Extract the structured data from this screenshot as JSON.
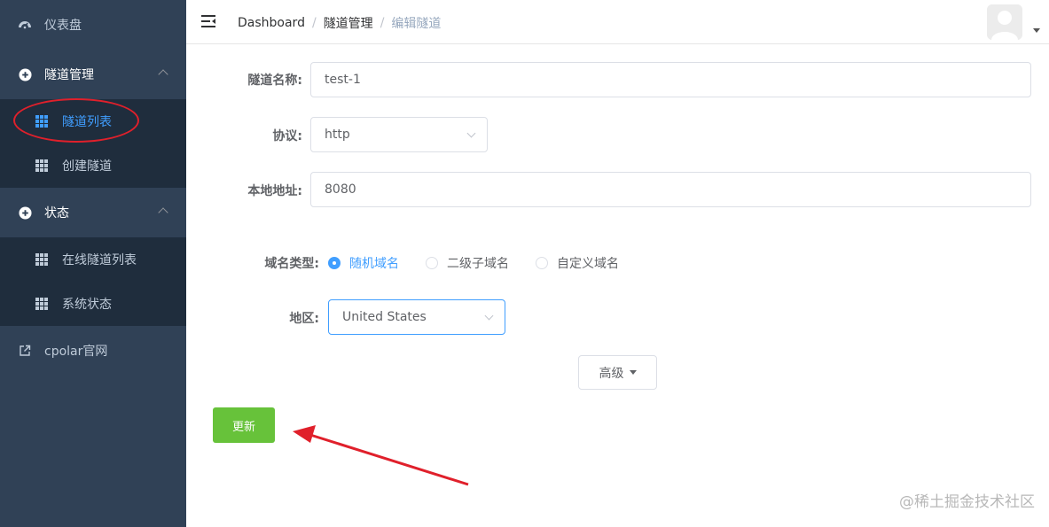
{
  "sidebar": {
    "dashboard": {
      "label": "仪表盘",
      "icon": "speedometer-icon"
    },
    "tunnel_mgmt": {
      "label": "隧道管理",
      "icon": "plus-circle-icon",
      "items": [
        {
          "label": "隧道列表",
          "icon": "table-icon",
          "active": true
        },
        {
          "label": "创建隧道",
          "icon": "table-icon"
        }
      ]
    },
    "status": {
      "label": "状态",
      "icon": "plus-circle-icon",
      "items": [
        {
          "label": "在线隧道列表",
          "icon": "table-icon"
        },
        {
          "label": "系统状态",
          "icon": "table-icon"
        }
      ]
    },
    "website": {
      "label": "cpolar官网",
      "icon": "external-link-icon"
    }
  },
  "header": {
    "breadcrumb": [
      "Dashboard",
      "隧道管理",
      "编辑隧道"
    ]
  },
  "form": {
    "name": {
      "label": "隧道名称:",
      "value": "test-1"
    },
    "protocol": {
      "label": "协议:",
      "value": "http"
    },
    "local_addr": {
      "label": "本地地址:",
      "value": "8080"
    },
    "domain_type": {
      "label": "域名类型:",
      "options": [
        "随机域名",
        "二级子域名",
        "自定义域名"
      ],
      "selected": "随机域名"
    },
    "region": {
      "label": "地区:",
      "value": "United States"
    },
    "advanced_label": "高级",
    "update_label": "更新"
  },
  "watermark": "@稀土掘金技术社区",
  "colors": {
    "sidebar_bg": "#304156",
    "active": "#409eff",
    "update_btn": "#67c23a",
    "annotation": "#e0202b"
  }
}
